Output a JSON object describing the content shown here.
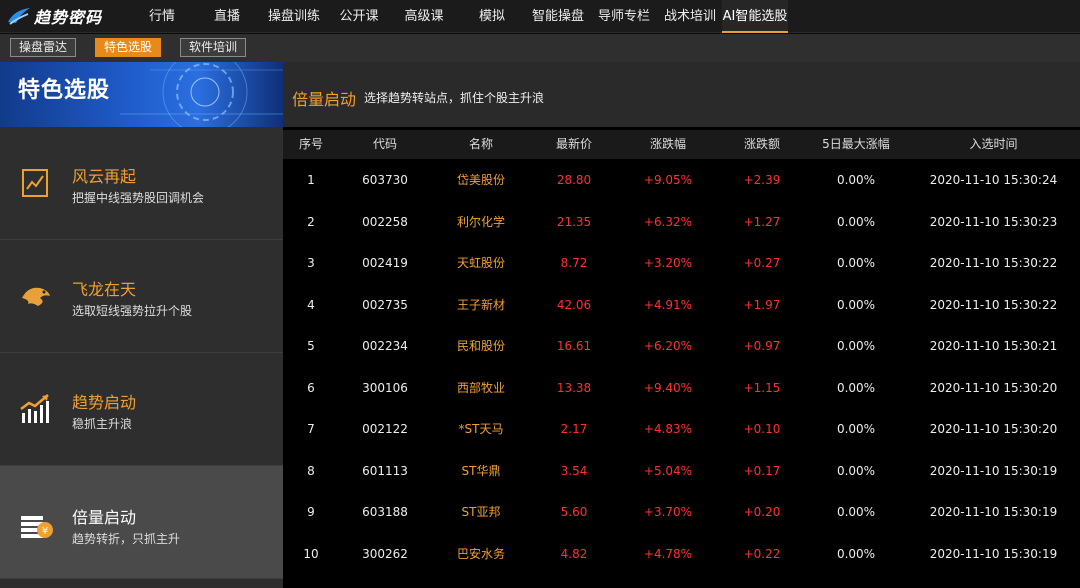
{
  "logo": {
    "text": "趋势密码"
  },
  "nav": {
    "items": [
      {
        "label": "行情"
      },
      {
        "label": "直播"
      },
      {
        "label": "操盘训练"
      },
      {
        "label": "公开课"
      },
      {
        "label": "高级课"
      },
      {
        "label": "模拟"
      },
      {
        "label": "智能操盘"
      },
      {
        "label": "导师专栏"
      },
      {
        "label": "战术培训"
      },
      {
        "label": "AI智能选股"
      }
    ],
    "active_index": 9
  },
  "subnav": {
    "items": [
      {
        "label": "操盘雷达"
      },
      {
        "label": "特色选股"
      },
      {
        "label": "软件培训"
      }
    ],
    "active_index": 1
  },
  "sidebar": {
    "banner_title": "特色选股",
    "items": [
      {
        "title": "风云再起",
        "desc": "把握中线强势股回调机会",
        "icon": "chart-doc-icon"
      },
      {
        "title": "飞龙在天",
        "desc": "选取短线强势拉升个股",
        "icon": "dragon-icon"
      },
      {
        "title": "趋势启动",
        "desc": "稳抓主升浪",
        "icon": "bar-trend-icon"
      },
      {
        "title": "倍量启动",
        "desc": "趋势转折，只抓主升",
        "icon": "money-stack-icon"
      }
    ],
    "active_index": 3
  },
  "main": {
    "title": "倍量启动",
    "subtitle": "选择趋势转站点，抓住个股主升浪"
  },
  "table": {
    "headers": [
      "序号",
      "代码",
      "名称",
      "最新价",
      "涨跌幅",
      "涨跌额",
      "5日最大涨幅",
      "入选时间"
    ],
    "rows": [
      [
        "1",
        "603730",
        "岱美股份",
        "28.80",
        "+9.05%",
        "+2.39",
        "0.00%",
        "2020-11-10 15:30:24"
      ],
      [
        "2",
        "002258",
        "利尔化学",
        "21.35",
        "+6.32%",
        "+1.27",
        "0.00%",
        "2020-11-10 15:30:23"
      ],
      [
        "3",
        "002419",
        "天虹股份",
        "8.72",
        "+3.20%",
        "+0.27",
        "0.00%",
        "2020-11-10 15:30:22"
      ],
      [
        "4",
        "002735",
        "王子新材",
        "42.06",
        "+4.91%",
        "+1.97",
        "0.00%",
        "2020-11-10 15:30:22"
      ],
      [
        "5",
        "002234",
        "民和股份",
        "16.61",
        "+6.20%",
        "+0.97",
        "0.00%",
        "2020-11-10 15:30:21"
      ],
      [
        "6",
        "300106",
        "西部牧业",
        "13.38",
        "+9.40%",
        "+1.15",
        "0.00%",
        "2020-11-10 15:30:20"
      ],
      [
        "7",
        "002122",
        "*ST天马",
        "2.17",
        "+4.83%",
        "+0.10",
        "0.00%",
        "2020-11-10 15:30:20"
      ],
      [
        "8",
        "601113",
        "ST华鼎",
        "3.54",
        "+5.04%",
        "+0.17",
        "0.00%",
        "2020-11-10 15:30:19"
      ],
      [
        "9",
        "603188",
        "ST亚邦",
        "5.60",
        "+3.70%",
        "+0.20",
        "0.00%",
        "2020-11-10 15:30:19"
      ],
      [
        "10",
        "300262",
        "巴安水务",
        "4.82",
        "+4.78%",
        "+0.22",
        "0.00%",
        "2020-11-10 15:30:19"
      ]
    ]
  },
  "colors": {
    "accent": "#f0a030",
    "rise": "#ff3030",
    "active_tab": "#e88a1a"
  }
}
